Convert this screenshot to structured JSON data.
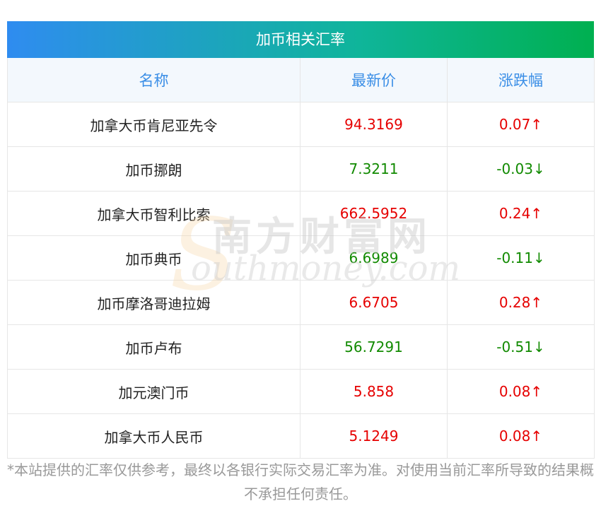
{
  "table": {
    "title": "加币相关汇率",
    "headers": [
      "名称",
      "最新价",
      "涨跌幅"
    ],
    "rows": [
      {
        "name": "加拿大币肯尼亚先令",
        "price": "94.3169",
        "change": "0.07↑",
        "dir": "up"
      },
      {
        "name": "加币挪朗",
        "price": "7.3211",
        "change": "-0.03↓",
        "dir": "down"
      },
      {
        "name": "加拿大币智利比索",
        "price": "662.5952",
        "change": "0.24↑",
        "dir": "up"
      },
      {
        "name": "加币典币",
        "price": "6.6989",
        "change": "-0.11↓",
        "dir": "down"
      },
      {
        "name": "加币摩洛哥迪拉姆",
        "price": "6.6705",
        "change": "0.28↑",
        "dir": "up"
      },
      {
        "name": "加币卢布",
        "price": "56.7291",
        "change": "-0.51↓",
        "dir": "down"
      },
      {
        "name": "加元澳门币",
        "price": "5.858",
        "change": "0.08↑",
        "dir": "up"
      },
      {
        "name": "加拿大币人民币",
        "price": "5.1249",
        "change": "0.08↑",
        "dir": "up"
      }
    ]
  },
  "watermark": {
    "chinese": "南方财富网",
    "english": "outhmoney.com",
    "letter": "S"
  },
  "disclaimer": "*本站提供的汇率仅供参考，最终以各银行实际交易汇率为准。对使用当前汇率所导致的结果概不承担任何责任。",
  "colors": {
    "up": "#e60000",
    "down": "#118a00",
    "header_text": "#3a8ee6",
    "title_gradient_start": "#2f8cf0",
    "title_gradient_end": "#00b050"
  }
}
